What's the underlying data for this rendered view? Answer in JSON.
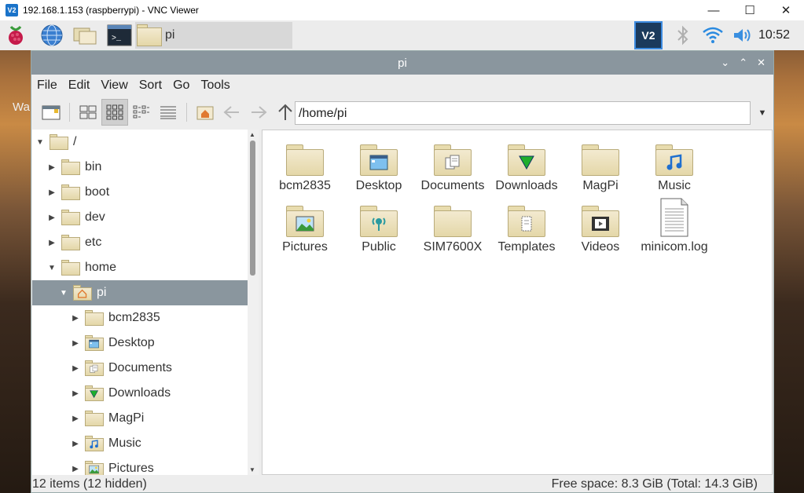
{
  "vnc": {
    "title": "192.168.1.153 (raspberrypi) - VNC Viewer",
    "logo": "V2",
    "minimize": "—",
    "maximize": "☐",
    "close": "✕"
  },
  "panel": {
    "task_label": "pi",
    "clock": "10:52",
    "side_text": "Wa"
  },
  "window": {
    "title": "pi",
    "ctl_min": "⌄",
    "ctl_max": "⌃",
    "ctl_close": "✕"
  },
  "menu": [
    "File",
    "Edit",
    "View",
    "Sort",
    "Go",
    "Tools"
  ],
  "path": "/home/pi",
  "tree": [
    {
      "label": "/",
      "arrow": "▼",
      "indent": 0,
      "icon": "folder"
    },
    {
      "label": "bin",
      "arrow": "▶",
      "indent": 1,
      "icon": "folder"
    },
    {
      "label": "boot",
      "arrow": "▶",
      "indent": 1,
      "icon": "folder"
    },
    {
      "label": "dev",
      "arrow": "▶",
      "indent": 1,
      "icon": "folder"
    },
    {
      "label": "etc",
      "arrow": "▶",
      "indent": 1,
      "icon": "folder"
    },
    {
      "label": "home",
      "arrow": "▼",
      "indent": 1,
      "icon": "folder"
    },
    {
      "label": "pi",
      "arrow": "▼",
      "indent": 2,
      "icon": "home",
      "selected": true
    },
    {
      "label": "bcm2835",
      "arrow": "▶",
      "indent": 3,
      "icon": "folder"
    },
    {
      "label": "Desktop",
      "arrow": "▶",
      "indent": 3,
      "icon": "desktop"
    },
    {
      "label": "Documents",
      "arrow": "▶",
      "indent": 3,
      "icon": "documents"
    },
    {
      "label": "Downloads",
      "arrow": "▶",
      "indent": 3,
      "icon": "downloads"
    },
    {
      "label": "MagPi",
      "arrow": "▶",
      "indent": 3,
      "icon": "folder"
    },
    {
      "label": "Music",
      "arrow": "▶",
      "indent": 3,
      "icon": "music"
    },
    {
      "label": "Pictures",
      "arrow": "▶",
      "indent": 3,
      "icon": "pictures"
    }
  ],
  "files": [
    {
      "label": "bcm2835",
      "icon": "folder"
    },
    {
      "label": "Desktop",
      "icon": "desktop"
    },
    {
      "label": "Documents",
      "icon": "documents"
    },
    {
      "label": "Downloads",
      "icon": "downloads"
    },
    {
      "label": "MagPi",
      "icon": "folder"
    },
    {
      "label": "Music",
      "icon": "music"
    },
    {
      "label": "Pictures",
      "icon": "pictures"
    },
    {
      "label": "Public",
      "icon": "public"
    },
    {
      "label": "SIM7600X",
      "icon": "folder"
    },
    {
      "label": "Templates",
      "icon": "templates"
    },
    {
      "label": "Videos",
      "icon": "videos"
    },
    {
      "label": "minicom.log",
      "icon": "file"
    }
  ],
  "status": {
    "left": "12 items (12 hidden)",
    "right": "Free space: 8.3 GiB (Total: 14.3 GiB)"
  },
  "colors": {
    "title_bar": "#8a969e",
    "folder": "#f3ead0",
    "accent": "#1a73c9"
  }
}
